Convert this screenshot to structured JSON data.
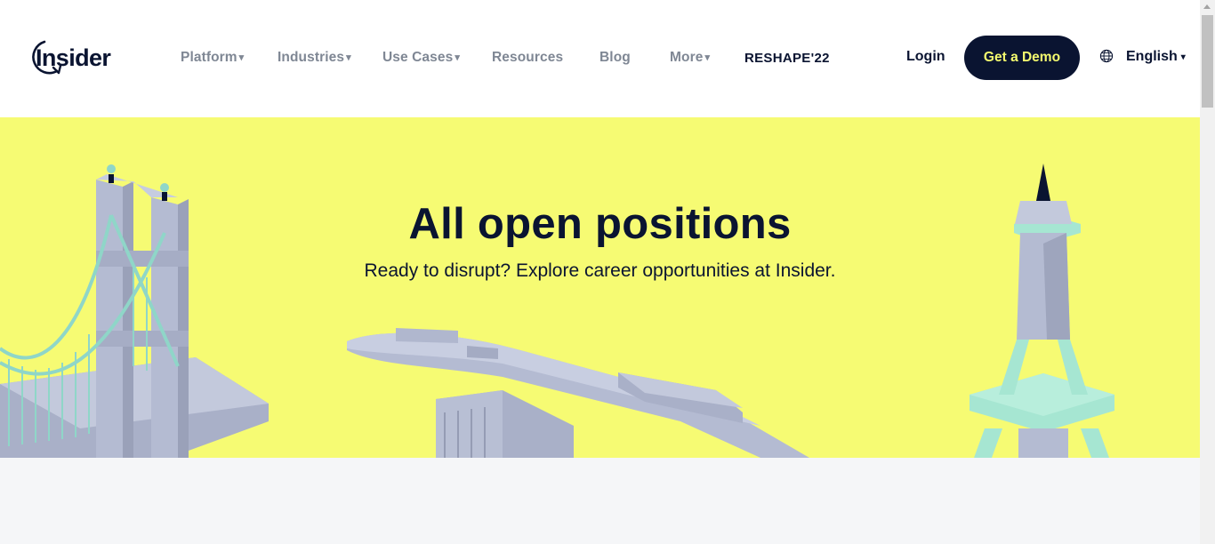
{
  "header": {
    "logo_text": "Insider",
    "nav": [
      {
        "label": "Platform",
        "caret": "▾"
      },
      {
        "label": "Industries",
        "caret": "▾"
      },
      {
        "label": "Use Cases",
        "caret": "▾"
      },
      {
        "label": "Resources",
        "caret": ""
      },
      {
        "label": "Blog",
        "caret": ""
      },
      {
        "label": "More",
        "caret": "▾"
      }
    ],
    "reshape_label": "RESHAPE'22",
    "login_label": "Login",
    "demo_label": "Get a Demo",
    "language_label": "English",
    "language_caret": "▾"
  },
  "hero": {
    "title": "All open positions",
    "subtitle": "Ready to disrupt? Explore career opportunities at Insider."
  },
  "colors": {
    "navy": "#0a1431",
    "hero_yellow": "#f6fb73",
    "demo_text": "#f5fb6f",
    "nav_gray": "#7f8794"
  },
  "icons": {
    "globe": "globe-icon",
    "caret": "caret-down-icon"
  }
}
